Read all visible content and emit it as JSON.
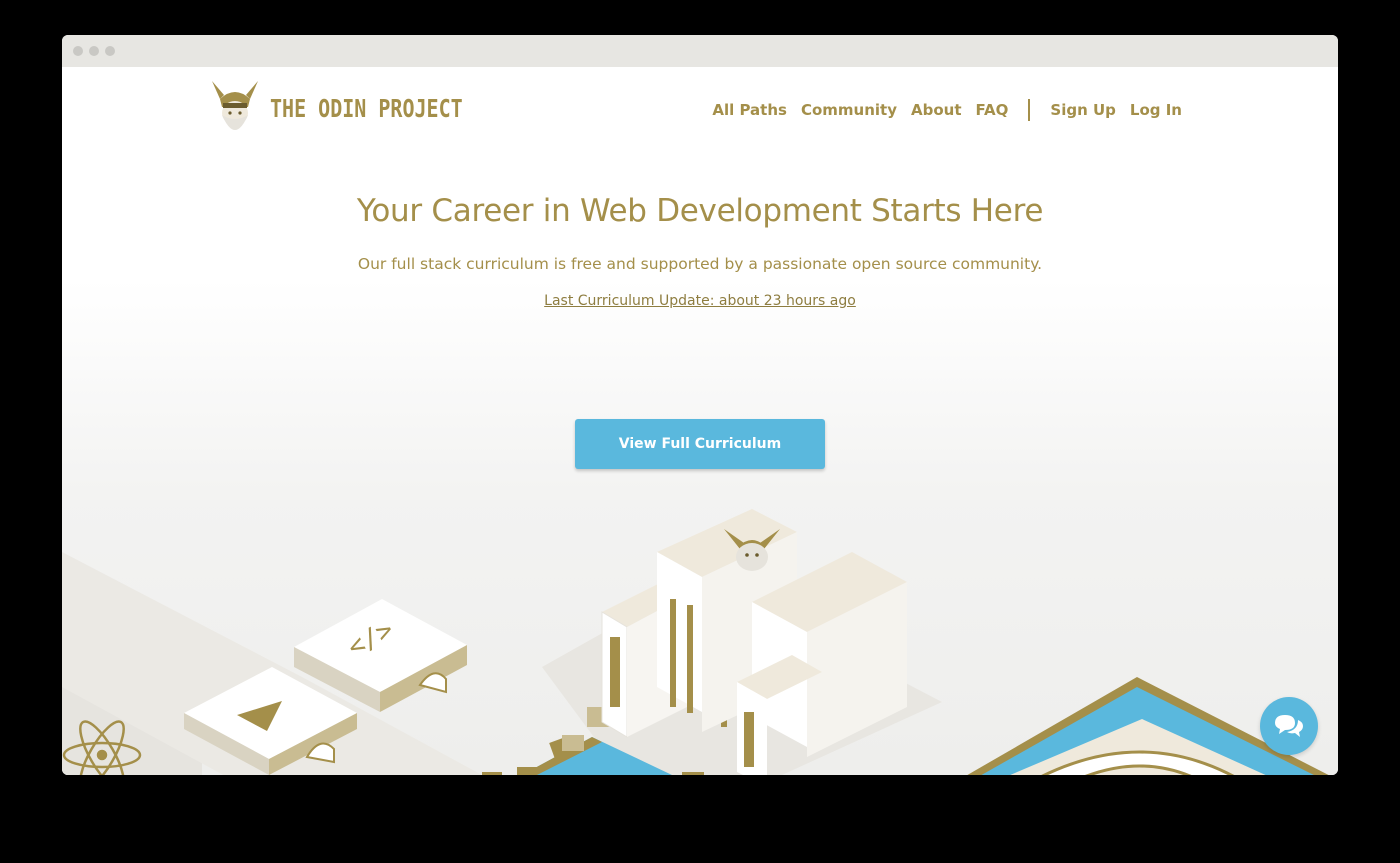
{
  "brand": {
    "name": "THE ODIN PROJECT"
  },
  "nav": {
    "items": [
      {
        "label": "All Paths"
      },
      {
        "label": "Community"
      },
      {
        "label": "About"
      },
      {
        "label": "FAQ"
      }
    ],
    "auth": [
      {
        "label": "Sign Up"
      },
      {
        "label": "Log In"
      }
    ]
  },
  "hero": {
    "title": "Your Career in Web Development Starts Here",
    "subtitle": "Our full stack curriculum is free and supported by a passionate open source community.",
    "update_link": "Last Curriculum Update: about 23 hours ago",
    "cta_label": "View Full Curriculum"
  },
  "colors": {
    "brand_gold": "#a48f4a",
    "accent_blue": "#5ab8dd"
  },
  "icons": {
    "logo": "viking-logo-icon",
    "chat": "chat-bubbles-icon"
  }
}
